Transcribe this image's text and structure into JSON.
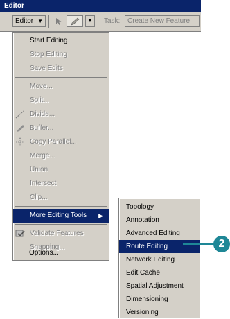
{
  "window": {
    "title": "Editor"
  },
  "toolbar": {
    "editor_menu_label": "Editor",
    "dropdown_arrow": "▼",
    "cursor_icon": "edit-pointer-icon",
    "pencil_icon": "sketch-tool-icon",
    "task_label": "Task:",
    "task_value": "Create New Feature"
  },
  "editor_menu": {
    "items": [
      {
        "label": "Start Editing",
        "enabled": true
      },
      {
        "label": "Stop Editing",
        "enabled": false
      },
      {
        "label": "Save Edits",
        "enabled": false
      },
      {
        "label": "Move...",
        "enabled": false
      },
      {
        "label": "Split...",
        "enabled": false
      },
      {
        "label": "Divide...",
        "enabled": false,
        "icon": "divide-icon"
      },
      {
        "label": "Buffer...",
        "enabled": false,
        "icon": "buffer-icon"
      },
      {
        "label": "Copy Parallel...",
        "enabled": false,
        "icon": "copy-parallel-icon"
      },
      {
        "label": "Merge...",
        "enabled": false
      },
      {
        "label": "Union",
        "enabled": false
      },
      {
        "label": "Intersect",
        "enabled": false
      },
      {
        "label": "Clip...",
        "enabled": false
      },
      {
        "label": "More Editing Tools",
        "enabled": true,
        "highlighted": true,
        "submenu": true
      },
      {
        "label": "Validate Features",
        "enabled": false,
        "icon": "validate-icon"
      },
      {
        "label": "Snapping...",
        "enabled": false
      },
      {
        "label": "Options...",
        "enabled": true
      }
    ],
    "submenu_arrow": "▶"
  },
  "sub_menu": {
    "items": [
      {
        "label": "Topology"
      },
      {
        "label": "Annotation"
      },
      {
        "label": "Advanced Editing"
      },
      {
        "label": "Route Editing",
        "highlighted": true
      },
      {
        "label": "Network Editing"
      },
      {
        "label": "Edit Cache"
      },
      {
        "label": "Spatial Adjustment"
      },
      {
        "label": "Dimensioning"
      },
      {
        "label": "Versioning"
      }
    ]
  },
  "callout": {
    "number": "2",
    "color": "#1e8796"
  },
  "colors": {
    "highlight": "#0a246a",
    "menu_bg": "#d4d0c8",
    "disabled_text": "#808080"
  }
}
